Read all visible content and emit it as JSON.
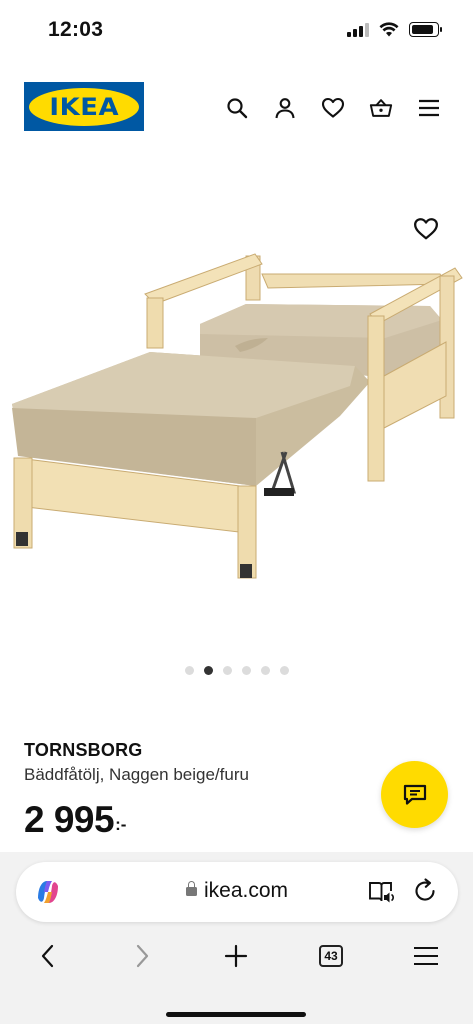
{
  "status_bar": {
    "time": "12:03"
  },
  "header": {
    "logo_text": "IKEA",
    "icons": [
      "search-icon",
      "account-icon",
      "heart-icon",
      "basket-icon",
      "menu-icon"
    ]
  },
  "gallery": {
    "image_alt": "TORNSBORG bäddfåtölj",
    "dot_count": 6,
    "active_dot": 2
  },
  "product": {
    "name": "TORNSBORG",
    "description": "Bäddfåtölj, Naggen beige/furu",
    "price": "2 995",
    "price_suffix": ":-"
  },
  "browser": {
    "url": "ikea.com",
    "tab_count": "43"
  },
  "colors": {
    "ikea_blue": "#0058a3",
    "ikea_yellow": "#ffdb00"
  }
}
